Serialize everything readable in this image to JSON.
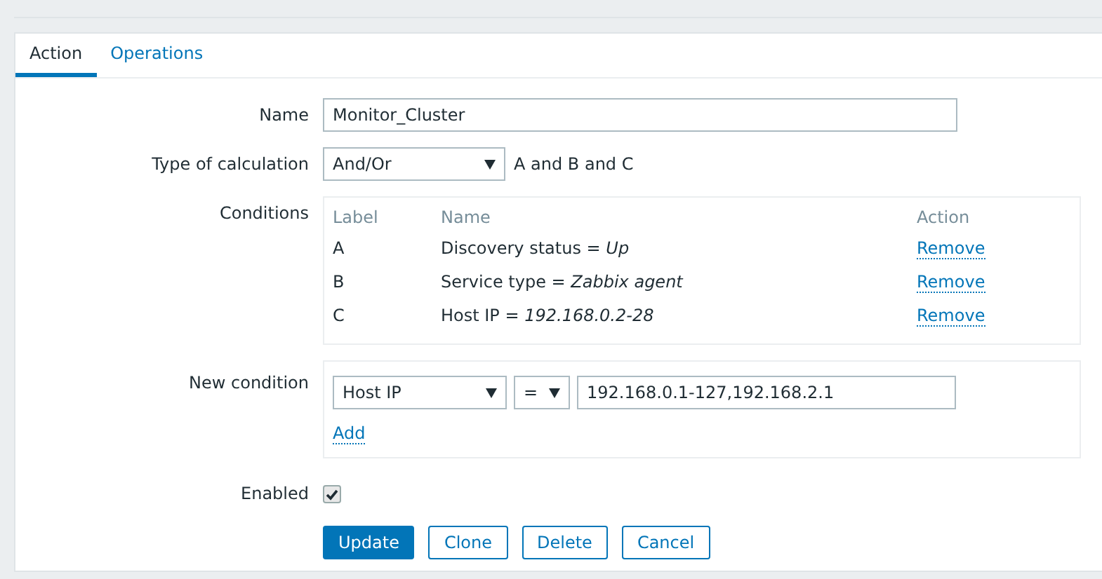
{
  "tabs": [
    {
      "label": "Action",
      "selected": true
    },
    {
      "label": "Operations",
      "selected": false
    }
  ],
  "name": {
    "label": "Name",
    "value": "Monitor_Cluster"
  },
  "calculation": {
    "label": "Type of calculation",
    "value": "And/Or",
    "formula": "A and B and C"
  },
  "conditions": {
    "label": "Conditions",
    "columns": [
      "Label",
      "Name",
      "Action"
    ],
    "rows": [
      {
        "label": "A",
        "name": "Discovery status = *Up*",
        "action": "Remove"
      },
      {
        "label": "B",
        "name": "Service type = *Zabbix agent*",
        "action": "Remove"
      },
      {
        "label": "C",
        "name": "Host IP = *192.168.0.2-28*",
        "action": "Remove"
      }
    ]
  },
  "new_condition": {
    "label": "New condition",
    "type": "Host IP",
    "operator": "=",
    "value": "192.168.0.1-127,192.168.2.1",
    "add": "Add"
  },
  "enabled": {
    "label": "Enabled",
    "checked": true
  },
  "buttons": [
    {
      "label": "Update",
      "kind": "primary"
    },
    {
      "label": "Clone",
      "kind": "secondary"
    },
    {
      "label": "Delete",
      "kind": "secondary"
    },
    {
      "label": "Cancel",
      "kind": "secondary"
    }
  ]
}
